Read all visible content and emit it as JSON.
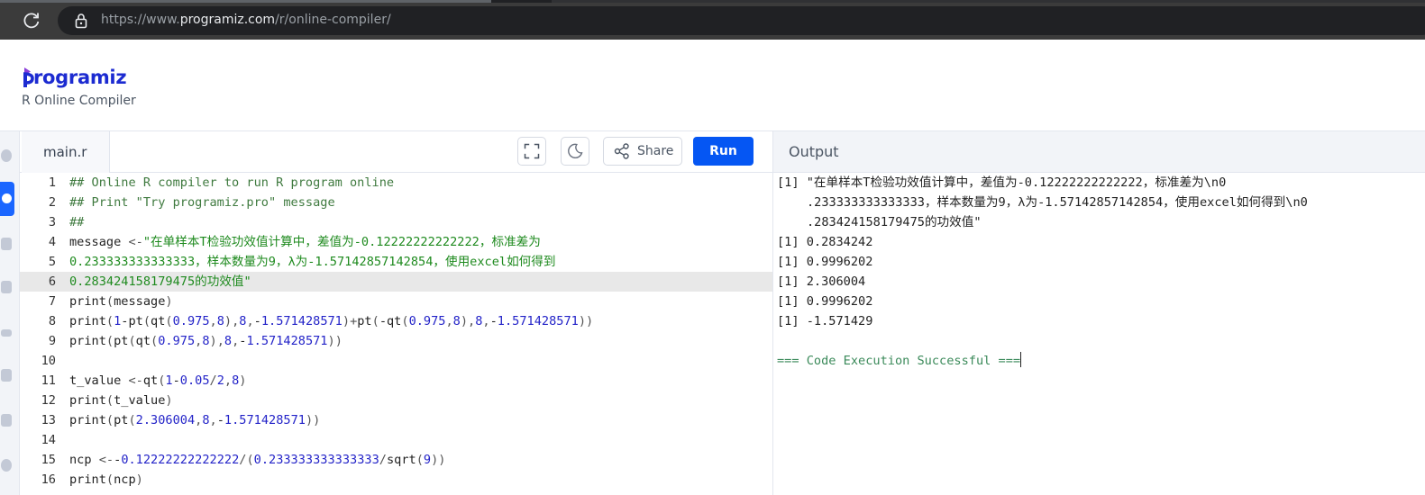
{
  "browser": {
    "url_prefix": "https://www.",
    "url_host": "programiz.com",
    "url_path": "/r/online-compiler/"
  },
  "header": {
    "logo_text": "rogramiz",
    "logo_letter": "P",
    "subtitle": "R Online Compiler"
  },
  "toolbar": {
    "file_tab": "main.r",
    "share_label": "Share",
    "run_label": "Run",
    "output_label": "Output"
  },
  "editor": {
    "lines": [
      {
        "n": "1",
        "text": "## Online R compiler to run R program online"
      },
      {
        "n": "2",
        "text": "## Print \"Try programiz.pro\" message"
      },
      {
        "n": "3",
        "text": "##"
      },
      {
        "n": "4",
        "text": "message <-\"在单样本T检验功效值计算中，差值为-0.12222222222222，标准差为"
      },
      {
        "n": "5",
        "text": "0.233333333333333，样本数量为9，λ为-1.57142857142854，使用excel如何得到"
      },
      {
        "n": "6",
        "text": "0.283424158179475的功效值\""
      },
      {
        "n": "7",
        "text": "print(message)"
      },
      {
        "n": "8",
        "text": "print(1-pt(qt(0.975,8),8,-1.571428571)+pt(-qt(0.975,8),8,-1.571428571))"
      },
      {
        "n": "9",
        "text": "print(pt(qt(0.975,8),8,-1.571428571))"
      },
      {
        "n": "10",
        "text": ""
      },
      {
        "n": "11",
        "text": "t_value <-qt(1-0.05/2,8)"
      },
      {
        "n": "12",
        "text": "print(t_value)"
      },
      {
        "n": "13",
        "text": "print(pt(2.306004,8,-1.571428571))"
      },
      {
        "n": "14",
        "text": ""
      },
      {
        "n": "15",
        "text": "ncp <--0.12222222222222/(0.233333333333333/sqrt(9))"
      },
      {
        "n": "16",
        "text": "print(ncp)"
      }
    ]
  },
  "output": {
    "lines": [
      "[1] \"在单样本T检验功效值计算中，差值为-0.12222222222222，标准差为\\n0",
      ".233333333333333，样本数量为9，λ为-1.57142857142854，使用excel如何得到\\n0",
      ".283424158179475的功效值\"",
      "[1] 0.2834242",
      "[1] 0.9996202",
      "[1] 2.306004",
      "[1] 0.9996202",
      "[1] -1.571429",
      "",
      "=== Code Execution Successful ==="
    ]
  },
  "colors": {
    "run_button": "#0556f3",
    "logo": "#1c2bd1",
    "comment": "#3f7a3f",
    "number": "#2323c8",
    "success": "#3b8a5a"
  }
}
